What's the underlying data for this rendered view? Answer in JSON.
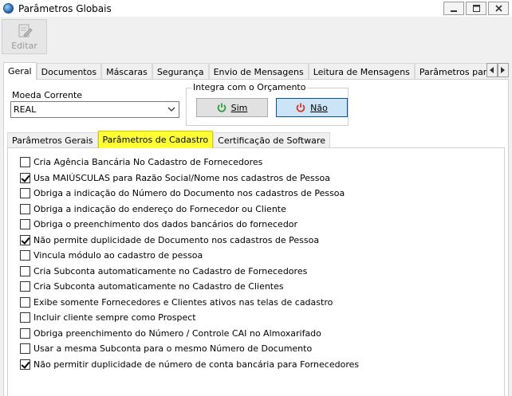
{
  "window": {
    "title": "Parâmetros Globais"
  },
  "toolbar": {
    "edit_label": "Editar"
  },
  "main_tabs": [
    {
      "label": "Geral",
      "active": true
    },
    {
      "label": "Documentos"
    },
    {
      "label": "Máscaras"
    },
    {
      "label": "Segurança"
    },
    {
      "label": "Envio de Mensagens"
    },
    {
      "label": "Leitura de Mensagens"
    },
    {
      "label": "Parâmetros para Co"
    }
  ],
  "moeda": {
    "label": "Moeda Corrente",
    "value": "REAL"
  },
  "integra": {
    "legend": "Integra com o Orçamento",
    "sim_label": "Sim",
    "nao_label": "Não"
  },
  "sub_tabs": [
    {
      "label": "Parâmetros Gerais"
    },
    {
      "label": "Parâmetros de Cadastro",
      "active": true
    },
    {
      "label": "Certificação de Software"
    }
  ],
  "options": [
    {
      "label": "Cria Agência Bancária No Cadastro de Fornecedores",
      "checked": false
    },
    {
      "label": "Usa MAIÚSCULAS para Razão Social/Nome nos cadastros de Pessoa",
      "checked": true
    },
    {
      "label": "Obriga a indicação do Número do Documento nos cadastros de Pessoa",
      "checked": false
    },
    {
      "label": "Obriga a indicação do endereço do Fornecedor ou Cliente",
      "checked": false
    },
    {
      "label": "Obriga o preenchimento dos dados bancários do fornecedor",
      "checked": false
    },
    {
      "label": "Não permite duplicidade de Documento nos cadastros de Pessoa",
      "checked": true
    },
    {
      "label": "Vincula módulo ao cadastro de pessoa",
      "checked": false
    },
    {
      "label": "Cria Subconta automaticamente no Cadastro de Fornecedores",
      "checked": false
    },
    {
      "label": "Cria Subconta automaticamente no Cadastro de Clientes",
      "checked": false
    },
    {
      "label": "Exibe somente Fornecedores e Clientes ativos nas telas de cadastro",
      "checked": false
    },
    {
      "label": "Incluir cliente sempre como Prospect",
      "checked": false
    },
    {
      "label": "Obriga preenchimento do Número / Controle CAI no Almoxarifado",
      "checked": false
    },
    {
      "label": "Usar a mesma Subconta para o mesmo Número de Documento",
      "checked": false
    },
    {
      "label": "Não permitir duplicidade de número de conta bancária para Fornecedores",
      "checked": true
    }
  ],
  "colors": {
    "highlight": "#ffff33",
    "nao_button": "#cce4f7",
    "sim_icon": "#2e9e3e",
    "nao_icon": "#d9381e"
  }
}
